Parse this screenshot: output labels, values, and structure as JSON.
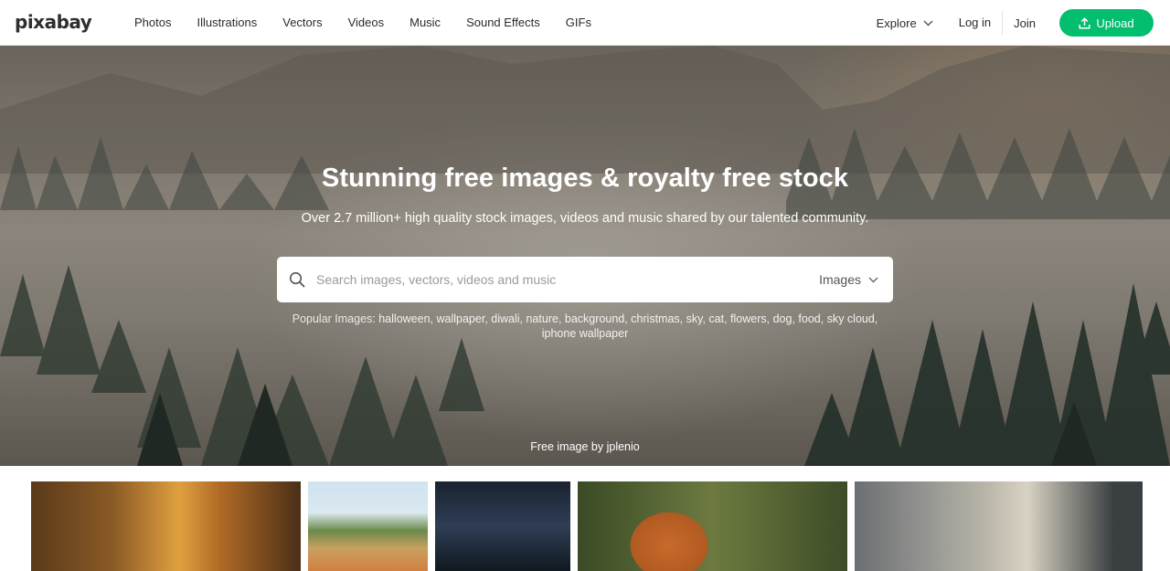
{
  "header": {
    "logo": "pixabay",
    "nav": [
      {
        "label": "Photos"
      },
      {
        "label": "Illustrations"
      },
      {
        "label": "Vectors"
      },
      {
        "label": "Videos"
      },
      {
        "label": "Music"
      },
      {
        "label": "Sound Effects"
      },
      {
        "label": "GIFs"
      }
    ],
    "explore_label": "Explore",
    "login_label": "Log in",
    "join_label": "Join",
    "upload_label": "Upload",
    "upload_color": "#02be6e"
  },
  "hero": {
    "title": "Stunning free images & royalty free stock",
    "subtitle": "Over 2.7 million+ high quality stock images, videos and music shared by our talented community.",
    "search": {
      "placeholder": "Search images, vectors, videos and music",
      "value": "",
      "type_selected": "Images"
    },
    "popular_prefix": "Popular Images:",
    "popular_tags": [
      "halloween",
      "wallpaper",
      "diwali",
      "nature",
      "background",
      "christmas",
      "sky",
      "cat",
      "flowers",
      "dog",
      "food",
      "sky cloud",
      "iphone wallpaper"
    ],
    "credit": "Free image by jplenio"
  },
  "icons": {
    "search": "search-icon",
    "chevron": "chevron-down-icon",
    "upload": "upload-icon"
  }
}
